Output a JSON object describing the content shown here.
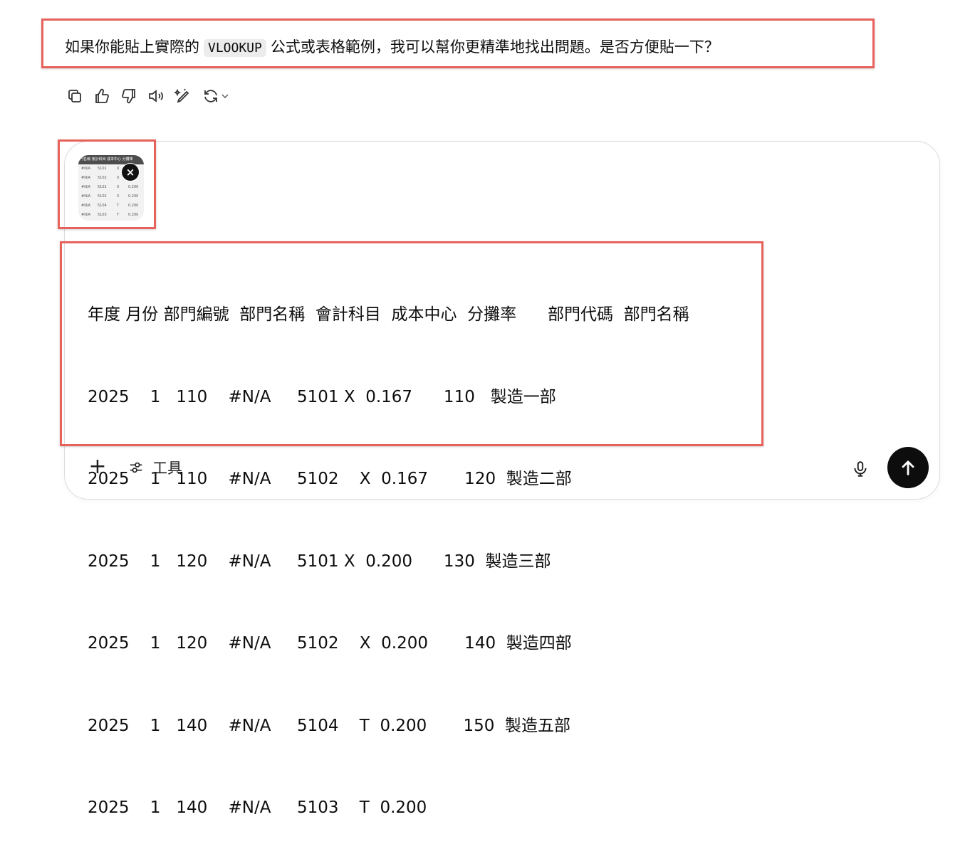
{
  "message": {
    "before": "如果你能貼上實際的",
    "code": "VLOOKUP",
    "after": "公式或表格範例，我可以幫你更精準地找出問題。是否方便貼一下？"
  },
  "actions": [
    {
      "icon": "copy-icon"
    },
    {
      "icon": "thumbs-up-icon"
    },
    {
      "icon": "thumbs-down-icon"
    },
    {
      "icon": "read-aloud-icon"
    },
    {
      "icon": "edit-canvas-icon"
    },
    {
      "icon": "regenerate-icon"
    }
  ],
  "attachment": {
    "header": "門名稱 會計科目 成本中心 分攤率",
    "rows": [
      [
        "#N/A",
        "5101",
        "X",
        ""
      ],
      [
        "#N/A",
        "5102",
        "X",
        "0.167"
      ],
      [
        "#N/A",
        "5101",
        "X",
        "0.200"
      ],
      [
        "#N/A",
        "5102",
        "X",
        "0.200"
      ],
      [
        "#N/A",
        "5104",
        "T",
        "0.200"
      ],
      [
        "#N/A",
        "5103",
        "T",
        "0.200"
      ]
    ],
    "remove_label": "×"
  },
  "composer": {
    "pasted_lines": [
      "年度 月份 部門編號  部門名稱  會計科目  成本中心  分攤率      部門代碼  部門名稱",
      "2025    1   110    #N/A     5101 X  0.167      110   製造一部",
      "2025    1   110    #N/A     5102    X  0.167       120  製造二部",
      "2025    1   120    #N/A     5101 X  0.200      130  製造三部",
      "2025    1   120    #N/A     5102    X  0.200       140  製造四部",
      "2025    1   140    #N/A     5104    T  0.200       150  製造五部",
      "2025    1   140    #N/A     5103    T  0.200"
    ],
    "add_label": "+",
    "tools_label": "工具",
    "mic_icon": "microphone-icon",
    "send_icon": "arrow-up-icon"
  },
  "colors": {
    "highlight": "#e8625c",
    "send_button": "#0d0d0d",
    "code_bg": "#ececec"
  }
}
